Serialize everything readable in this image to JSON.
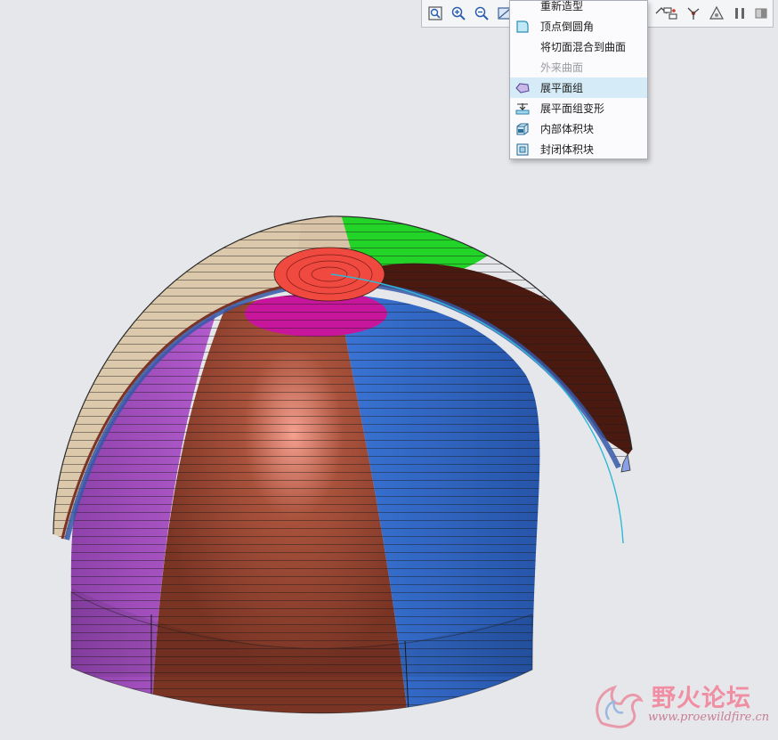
{
  "colors": {
    "background": "#e6e7ea",
    "segment_purple": "#9a4cb3",
    "segment_brown": "#8a3f2c",
    "segment_blue": "#2f5fb8",
    "segment_red": "#f04a40",
    "segment_green": "#18d21e",
    "segment_darkbrown": "#4a1a10",
    "segment_beige": "#d8c3a6",
    "segment_magenta": "#c8169c",
    "curve_cyan": "#2fb8d8",
    "menu_hover": "#d5ecf8"
  },
  "toolbar": {
    "icons": [
      "refit-icon",
      "zoom-in-icon",
      "zoom-out-icon",
      "view-icon",
      "datum-display-icon",
      "datum-axis-icon",
      "spin-center-icon",
      "annotation-icon",
      "pause-icon",
      "plane-icon"
    ]
  },
  "context_menu": {
    "items": [
      {
        "label": "重新造型",
        "icon": "",
        "state": "normal"
      },
      {
        "label": "顶点倒圆角",
        "icon": "vertex-round-icon",
        "state": "normal"
      },
      {
        "label": "将切面混合到曲面",
        "icon": "",
        "state": "normal"
      },
      {
        "label": "外来曲面",
        "icon": "",
        "state": "disabled"
      },
      {
        "label": "展平面组",
        "icon": "flatten-quilt-icon",
        "state": "hover"
      },
      {
        "label": "展平面组变形",
        "icon": "flatten-deform-icon",
        "state": "normal"
      },
      {
        "label": "内部体积块",
        "icon": "inner-volume-icon",
        "state": "normal"
      },
      {
        "label": "封闭体积块",
        "icon": "closed-volume-icon",
        "state": "normal"
      }
    ]
  },
  "watermark": {
    "title": "野火论坛",
    "url": "www.proewildfire.cn"
  }
}
